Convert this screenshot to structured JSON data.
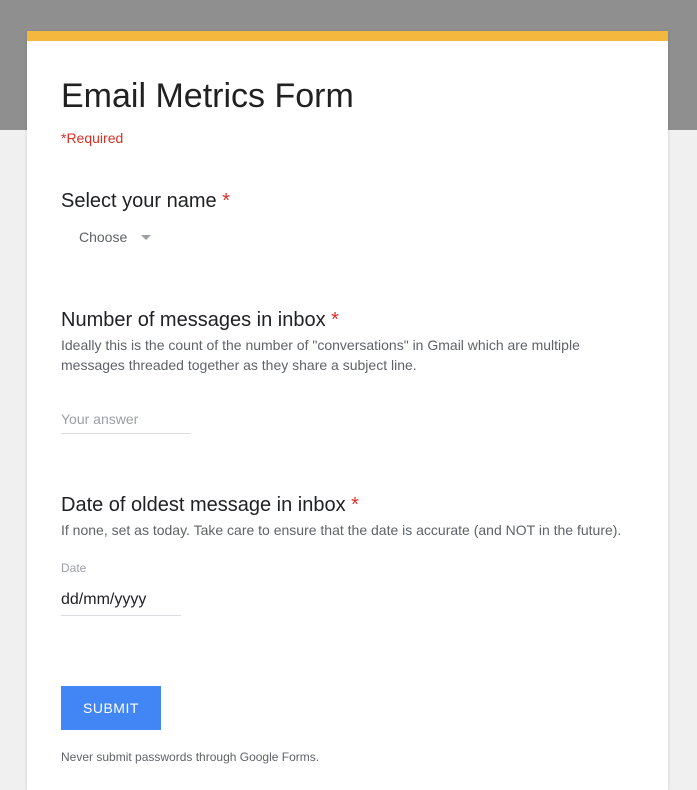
{
  "form": {
    "title": "Email Metrics Form",
    "required_note": "*Required",
    "fields": {
      "name": {
        "label": "Select your name ",
        "asterisk": "*",
        "select_value": "Choose"
      },
      "messages": {
        "label": "Number of messages in inbox ",
        "asterisk": "*",
        "description": "Ideally this is the count of the number of \"conversations\" in Gmail which are multiple messages threaded together as they share a subject line.",
        "placeholder": "Your answer"
      },
      "date": {
        "label": "Date of oldest message in inbox ",
        "asterisk": "*",
        "description": "If none, set as today. Take care to ensure that the date is accurate (and NOT in the future).",
        "sublabel": "Date",
        "value": "dd/mm/yyyy"
      }
    },
    "submit_label": "SUBMIT",
    "footer": "Never submit passwords through Google Forms."
  }
}
